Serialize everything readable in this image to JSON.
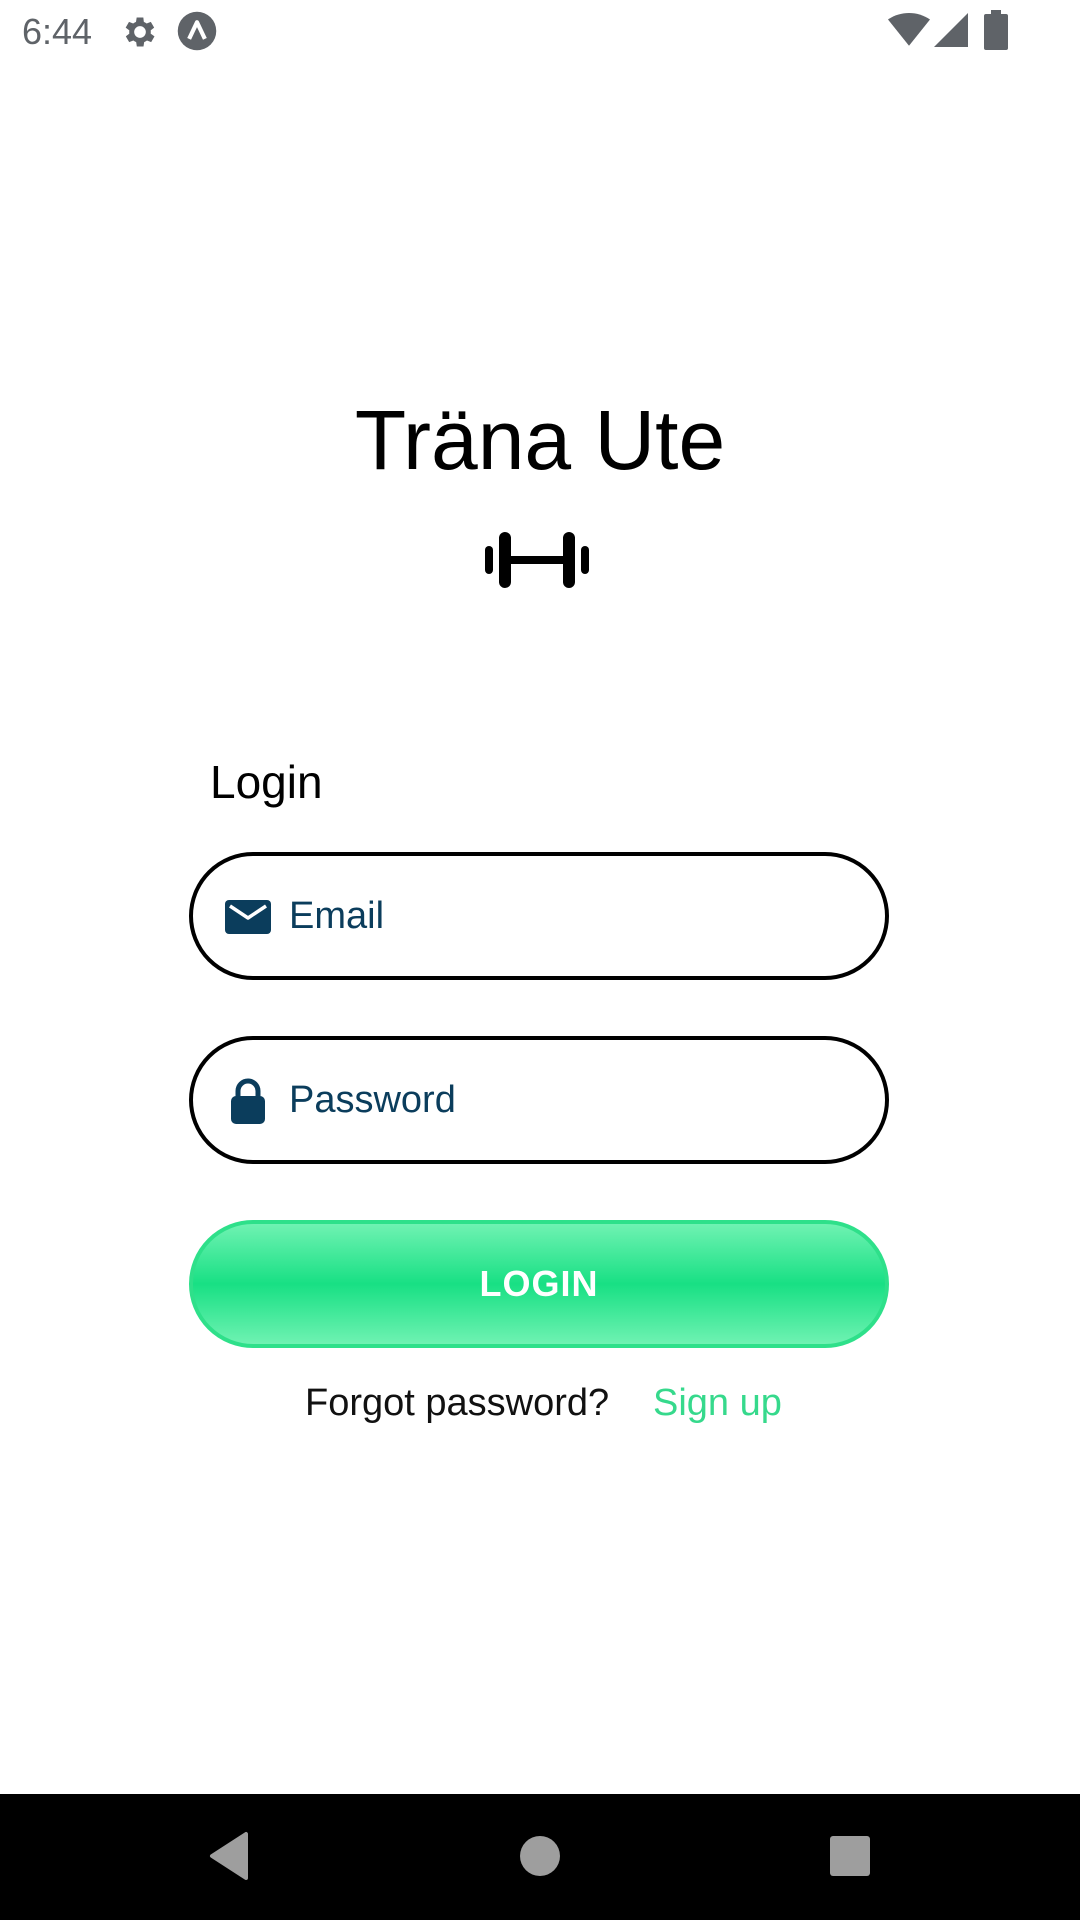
{
  "status_bar": {
    "time": "6:44",
    "icons": [
      "gear-icon",
      "app-notification-icon",
      "wifi-icon",
      "cellular-signal-icon",
      "battery-icon"
    ]
  },
  "app": {
    "title": "Träna Ute",
    "logo_icon": "dumbbell-icon"
  },
  "login_form": {
    "heading": "Login",
    "email": {
      "icon": "mail-icon",
      "placeholder": "Email",
      "value": ""
    },
    "password": {
      "icon": "lock-icon",
      "placeholder": "Password",
      "value": ""
    },
    "submit_label": "LOGIN",
    "forgot_password_label": "Forgot password?",
    "signup_label": "Sign up"
  },
  "colors": {
    "accent_green": "#18e084",
    "link_green": "#36d98c",
    "input_text": "#0b3d5c",
    "nav_bar": "#000000"
  },
  "nav_bar": {
    "buttons": [
      "back-icon",
      "home-icon",
      "recents-icon"
    ]
  }
}
